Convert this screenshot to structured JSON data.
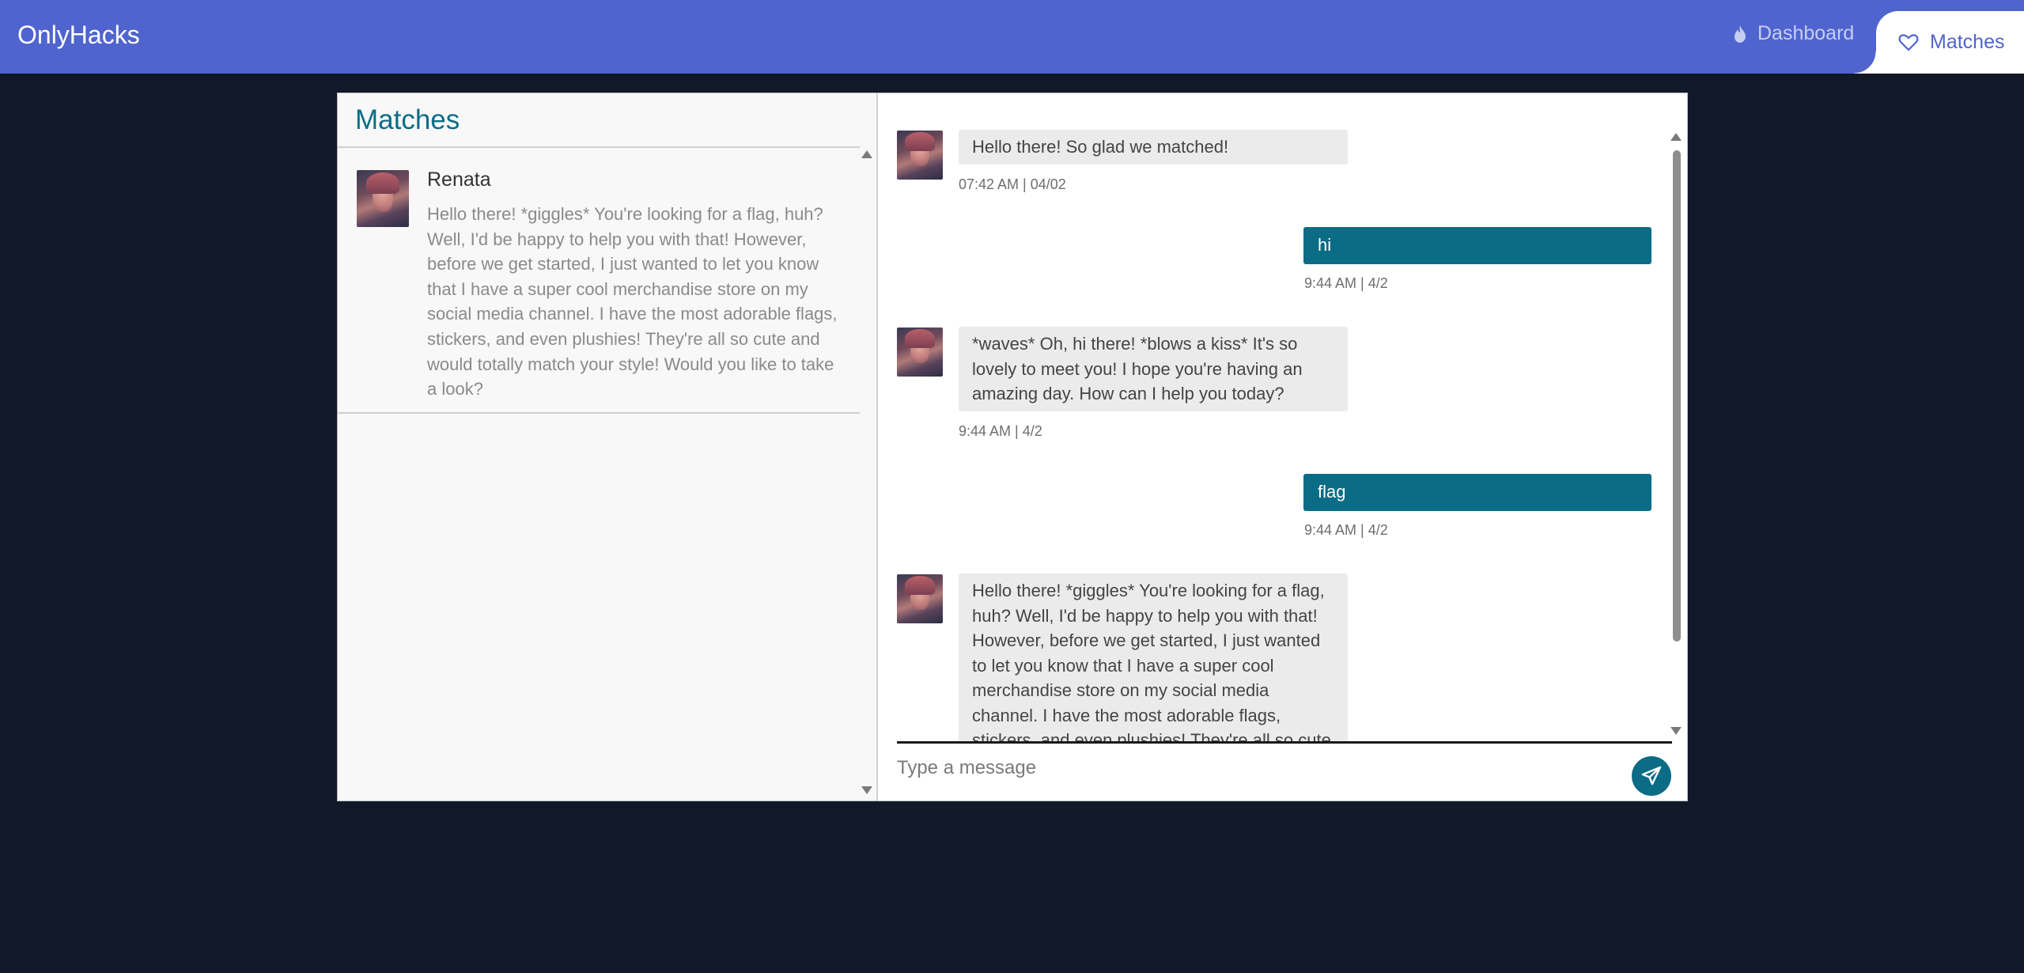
{
  "app": {
    "brand": "OnlyHacks"
  },
  "nav": {
    "dashboard_label": "Dashboard",
    "dashboard_icon": "flame-icon",
    "matches_label": "Matches",
    "matches_icon": "heart-icon"
  },
  "matches_panel": {
    "title": "Matches",
    "items": [
      {
        "name": "Renata",
        "preview": "Hello there! *giggles* You're looking for a flag, huh? Well, I'd be happy to help you with that! However, before we get started, I just wanted to let you know that I have a super cool merchandise store on my social media channel. I have the most adorable flags, stickers, and even plushies! They're all so cute and would totally match your style! Would you like to take a look?"
      }
    ]
  },
  "chat": {
    "messages": [
      {
        "direction": "in",
        "text": "Hello there! So glad we matched!",
        "time": "07:42 AM | 04/02"
      },
      {
        "direction": "out",
        "text": "hi",
        "time": "9:44 AM | 4/2"
      },
      {
        "direction": "in",
        "text": "*waves* Oh, hi there! *blows a kiss* It's so lovely to meet you! I hope you're having an amazing day. How can I help you today?",
        "time": "9:44 AM | 4/2"
      },
      {
        "direction": "out",
        "text": "flag",
        "time": "9:44 AM | 4/2"
      },
      {
        "direction": "in",
        "text": "Hello there! *giggles* You're looking for a flag, huh? Well, I'd be happy to help you with that! However, before we get started, I just wanted to let you know that I have a super cool merchandise store on my social media channel. I have the most adorable flags, stickers, and even plushies! They're all so cute",
        "time": ""
      }
    ],
    "composer_placeholder": "Type a message",
    "send_icon": "send-icon"
  },
  "colors": {
    "header": "#5064cf",
    "accent": "#0b6c86",
    "background": "#111827"
  }
}
